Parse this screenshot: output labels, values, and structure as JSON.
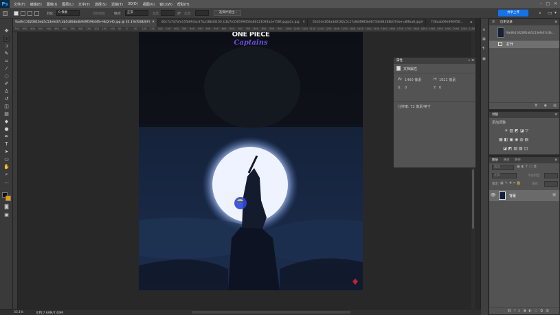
{
  "app": {
    "logo": "Ps"
  },
  "menu": [
    "文件(F)",
    "编辑(E)",
    "图像(I)",
    "图层(L)",
    "文字(Y)",
    "选择(S)",
    "滤镜(T)",
    "3D(D)",
    "视图(V)",
    "窗口(W)",
    "帮助(H)"
  ],
  "options": {
    "feather_label": "羽化:",
    "feather_value": "0 像素",
    "antialias_label": "消除锯齿",
    "style_label": "样式:",
    "style_value": "正常",
    "width_label": "宽度:",
    "height_label": "高度:",
    "select_mask_button": "选择并遮住...",
    "share_button": "共享上传"
  },
  "tabs": [
    {
      "label": "9adfe11620816eb5c53efe37cdb5c80dbdb949f59644fe-HkQnH5.jpg @ 33.1%(RGB/8#)",
      "active": true
    },
    {
      "label": "80c7a7d7afe15fb694acd7ba18b43100_b1b7e558599456a80121093a2e758f.jpg@2x.jpg",
      "active": false
    },
    {
      "label": "63d1de264ad48182c5c27a8d4985b08733e84288b07ebe-u89ba8.jpg",
      "active": false
    },
    {
      "label": "738aab69e696956...",
      "active": false
    }
  ],
  "ruler_ticks": [
    "700",
    "650",
    "600",
    "550",
    "500",
    "450",
    "400",
    "350",
    "300",
    "250",
    "200",
    "150",
    "100",
    "50",
    "0",
    "50",
    "100",
    "150",
    "200",
    "250",
    "300",
    "350",
    "400",
    "450",
    "500",
    "550",
    "600",
    "650",
    "700",
    "750",
    "800",
    "850",
    "900",
    "950",
    "1000",
    "1050",
    "1100",
    "1150",
    "1200",
    "1250",
    "1300",
    "1350",
    "1400",
    "1450",
    "1500",
    "1550",
    "1600",
    "1650",
    "1700",
    "1750",
    "1800",
    "1850",
    "1900",
    "1950",
    "2000",
    "2050",
    "2100",
    "2150"
  ],
  "artwork": {
    "title": "ONE PIECE",
    "subtitle": "Captains"
  },
  "properties": {
    "title": "属性",
    "doc_label": "文档属性",
    "w_label": "W:",
    "w_value": "1460 像素",
    "h_label": "H:",
    "h_value": "1921 像素",
    "x_label": "X:",
    "x_value": "0",
    "y_label": "Y:",
    "y_value": "0",
    "resolution": "分辨率: 72 像素/英寸"
  },
  "history": {
    "tabs": [
      "库",
      "历史记录"
    ],
    "snapshot": "9adfe1162081eb5c53efe37cdb...",
    "steps": [
      "打开"
    ]
  },
  "adjustments": {
    "title": "调整",
    "add_label": "添加调整"
  },
  "layers": {
    "tabs": [
      "图层",
      "通道",
      "路径"
    ],
    "kind_placeholder": "类型",
    "blend_mode": "正常",
    "opacity_label": "不透明度:",
    "lock_label": "锁定:",
    "fill_label": "填充:",
    "layer_name": "背景"
  },
  "status": {
    "zoom": "33.1%",
    "doc": "文档:7.69M/7.69M"
  },
  "colors": {
    "accent": "#31a8ff",
    "panel": "#535353",
    "dark": "#282828"
  }
}
